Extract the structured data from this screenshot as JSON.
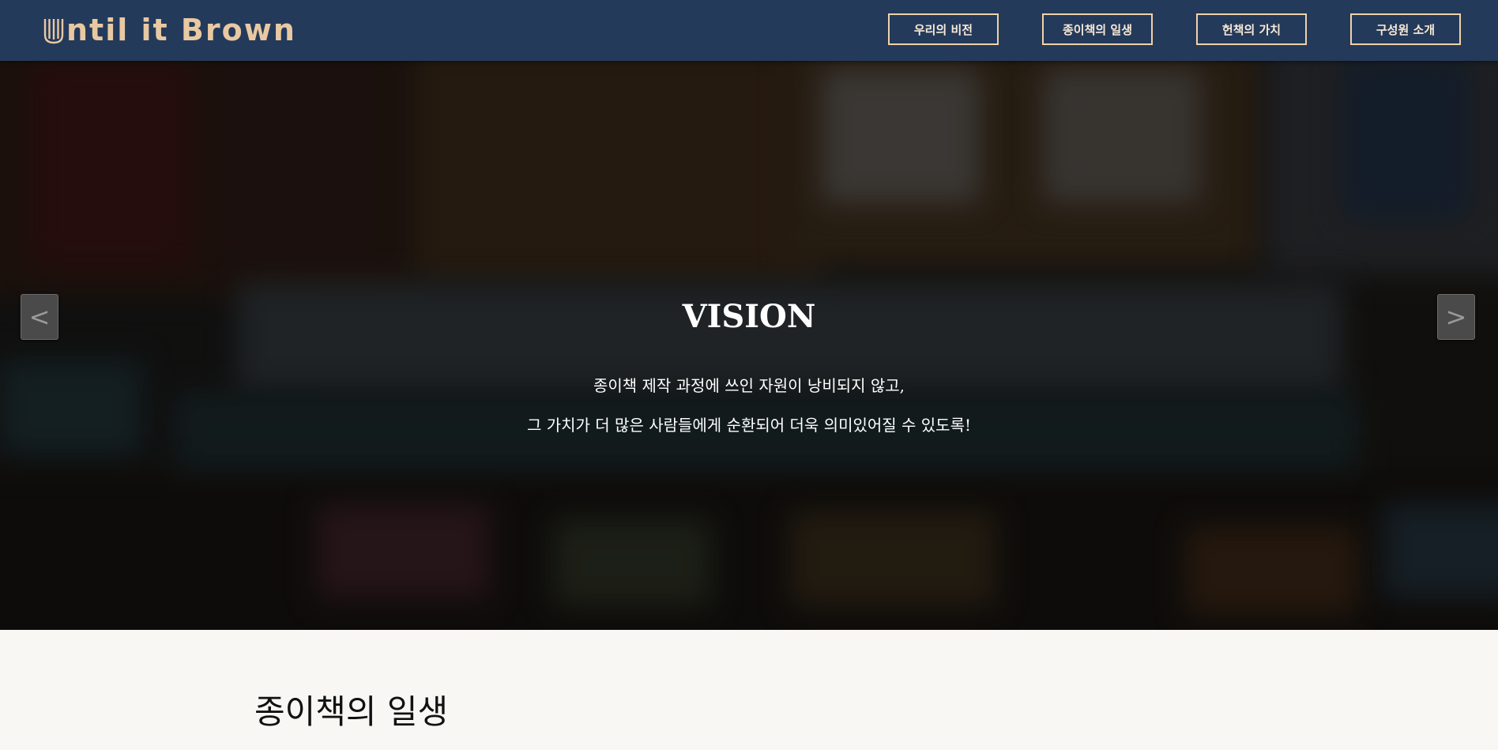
{
  "header": {
    "logo_text": "ntil it Brown",
    "logo_full": "Until it Brown",
    "logo_color": "#e9c9a2",
    "background_color": "#243a5b",
    "nav": [
      {
        "label": "우리의 비전"
      },
      {
        "label": "종이책의 일생"
      },
      {
        "label": "헌책의 가치"
      },
      {
        "label": "구성원 소개"
      }
    ]
  },
  "hero": {
    "title": "VISION",
    "line1": "종이책 제작 과정에 쓰인 자원이 낭비되지 않고,",
    "line2": "그 가치가 더 많은 사람들에게 순환되어 더욱 의미있어질 수 있도록!",
    "prev_label": "<",
    "next_label": ">"
  },
  "section": {
    "title": "종이책의 일생"
  }
}
